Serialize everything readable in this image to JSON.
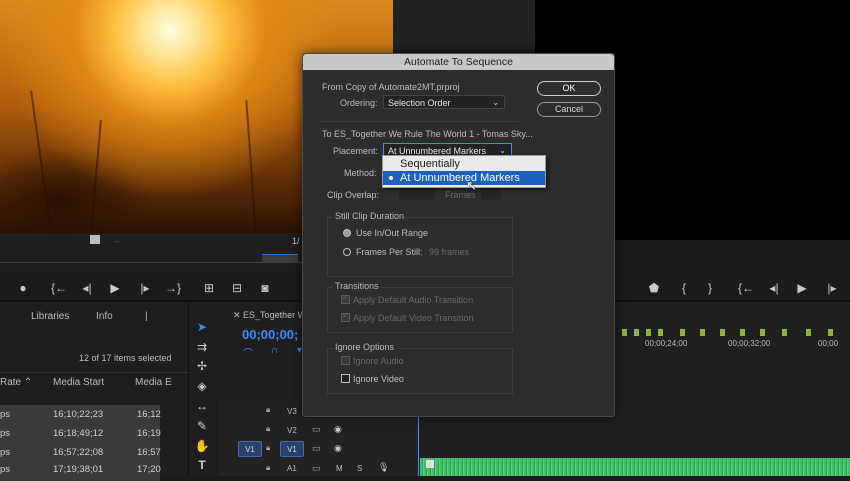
{
  "source_monitor": {
    "page_indicator": "1/"
  },
  "panels": {
    "tabs": [
      "Libraries",
      "Info",
      "|"
    ],
    "items_count": "12 of 17 items selected",
    "columns": [
      "Rate",
      "Media Start",
      "Media E"
    ],
    "rows": [
      {
        "rate": "ps",
        "start": "16;10;22;23",
        "end": "16;12"
      },
      {
        "rate": "ps",
        "start": "16;18;49;12",
        "end": "16;19"
      },
      {
        "rate": "ps",
        "start": "16;57;22;08",
        "end": "16;57"
      },
      {
        "rate": "ps",
        "start": "17;19;38;01",
        "end": "17;20"
      }
    ]
  },
  "timeline": {
    "tab": "ES_Together W",
    "timecode": "00;00;00;",
    "ruler": [
      "00;00;24;00",
      "00;00;32;00",
      "00;00"
    ],
    "tracks": [
      "V3",
      "V2",
      "V1",
      "A1"
    ],
    "source_patch": "V1",
    "track_m": "M",
    "track_s": "S"
  },
  "dialog": {
    "title": "Automate To Sequence",
    "from_label": "From Copy of Automate2MT.prproj",
    "ordering_label": "Ordering:",
    "ordering_value": "Selection Order",
    "to_label": "To ES_Together We Rule The World 1 - Tomas Sky...",
    "placement_label": "Placement:",
    "placement_value": "At Unnumbered Markers",
    "method_label": "Method:",
    "clip_overlap_label": "Clip Overlap:",
    "clip_overlap_unit": "Frames",
    "ok_label": "OK",
    "cancel_label": "Cancel",
    "still_clip_title": "Still Clip Duration",
    "use_inout": "Use In/Out Range",
    "frames_per_still": "Frames Per Still:",
    "frames_value": "99 frames",
    "transitions_title": "Transitions",
    "audio_transition": "Apply Default Audio Transition",
    "video_transition": "Apply Default Video Transition",
    "ignore_title": "Ignore Options",
    "ignore_audio": "Ignore Audio",
    "ignore_video": "Ignore Video"
  },
  "placement_dropdown": {
    "options": [
      "Sequentially",
      "At Unnumbered Markers"
    ],
    "selected_index": 1
  },
  "colors": {
    "accent": "#1d5fbf",
    "timecode": "#3d8bff",
    "markers": "#8fb34a",
    "audio_wave": "#3fbf6a"
  }
}
